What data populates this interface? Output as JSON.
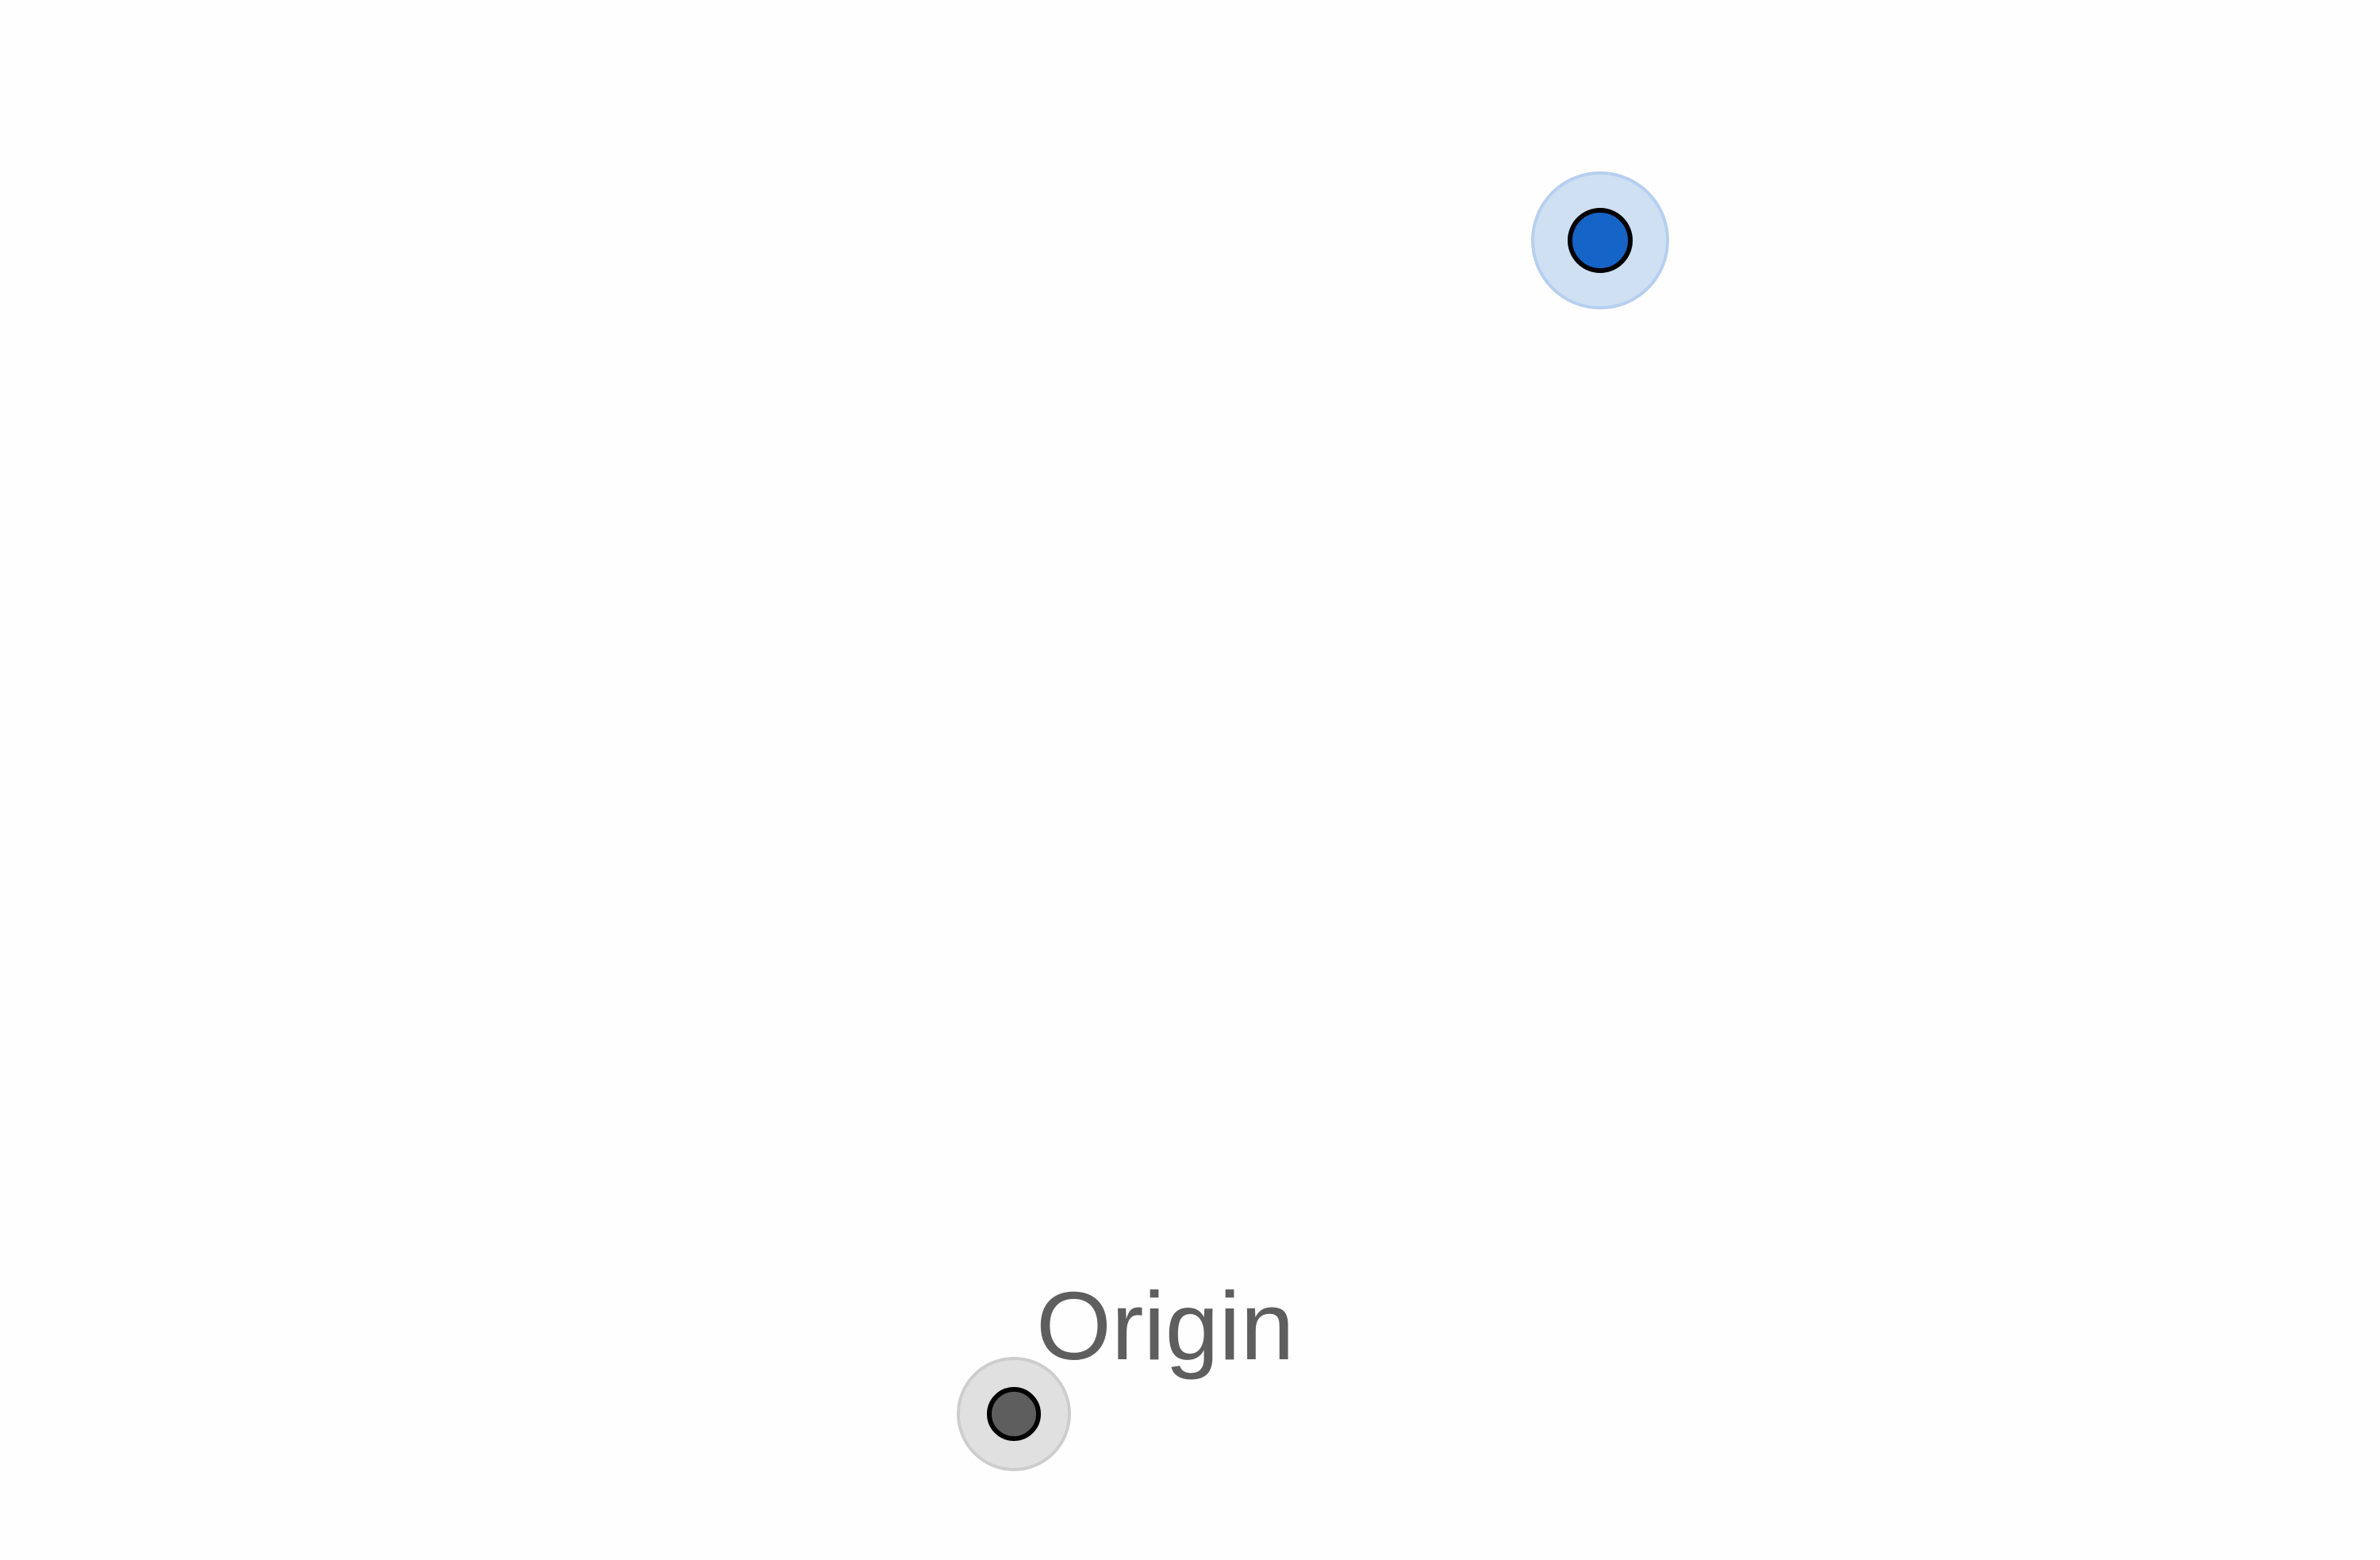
{
  "map": {
    "background_color": "#fefefe",
    "current_location": {
      "icon": "location-dot-icon",
      "fill_color": "#1565c8",
      "halo_color": "#cfe0f3"
    },
    "origin": {
      "label": "Origin",
      "icon": "origin-dot-icon",
      "fill_color": "#5e5e5e",
      "halo_color": "#e0e0e0",
      "label_color": "#5e5e5e"
    }
  }
}
